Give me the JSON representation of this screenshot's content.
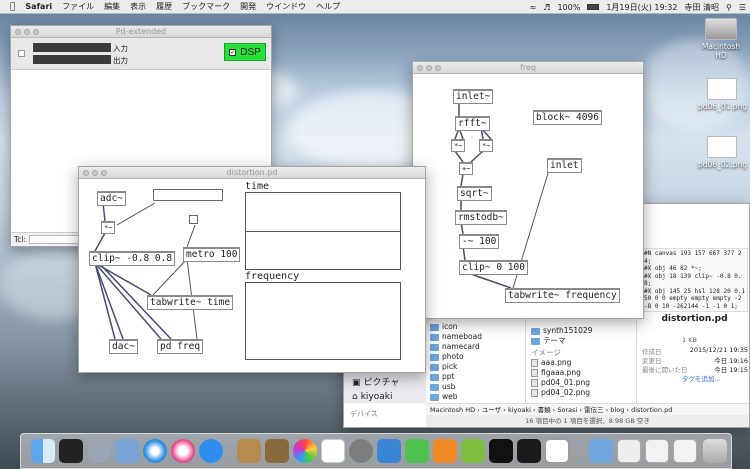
{
  "menubar": {
    "app": "Safari",
    "menus": [
      "ファイル",
      "編集",
      "表示",
      "履歴",
      "ブックマーク",
      "開発",
      "ウインドウ",
      "ヘルプ"
    ],
    "battery": "100%",
    "datetime": "1月19日(火)  19:32",
    "user": "寺田 清昭"
  },
  "pd_main": {
    "title": "Pd-extended",
    "input_label": "入力",
    "output_label": "出力",
    "dsp_label": "DSP",
    "tcl_label": "Tcl:"
  },
  "distortion": {
    "title": "distortion.pd",
    "array_time_label": "time",
    "array_freq_label": "frequency",
    "objects": {
      "adc": "adc~",
      "mult": "*~",
      "clip": "clip~ -0.8 0.8",
      "metro": "metro 100",
      "tabwrite": "tabwrite~ time",
      "dac": "dac~",
      "pd_freq": "pd freq"
    }
  },
  "freq": {
    "title": "freq",
    "objects": {
      "inlet_sig": "inlet~",
      "rfft": "rfft~",
      "mult_a": "*~",
      "mult_b": "*~",
      "plus": "+~",
      "sqrt": "sqrt~",
      "rmstodb": "rmstodb~",
      "minus": "-~ 100",
      "clip": "clip~ 0 100",
      "tabwrite": "tabwrite~ frequency",
      "block": "block~ 4096",
      "inlet": "inlet"
    }
  },
  "finder": {
    "sidebar": [
      "ピクチャ",
      "kiyoaki",
      "デバイス"
    ],
    "col1": [
      "icon",
      "nameboad",
      "namecard",
      "photo",
      "pick",
      "ppt",
      "usb",
      "web"
    ],
    "col2_folders": [
      "synth151029",
      "テーマ"
    ],
    "col2_header": "イメージ",
    "col2_files": [
      "aaa.png",
      "figaaa.png",
      "pd04_01.png",
      "pd04_02.png"
    ],
    "preview_text": "#N canvas 193 157 667 377 24;\n#X obj 46 82 *~;\n#X obj 18 139 clip~ -0.8 0.8;\n#X obj 145 25 hsl 128 20 0.1 50 0 0 empty empty empty -2 -8 0 10 -262144 -1 -1 0 1;",
    "file_name": "distortion.pd",
    "file_size": "1 KB",
    "info": [
      {
        "k": "作成日",
        "v": "2015/12/21 19:35"
      },
      {
        "k": "変更日",
        "v": "今日 19:16"
      },
      {
        "k": "最後に開いた日",
        "v": "今日 19:15"
      }
    ],
    "add_tag": "タグを追加...",
    "path": [
      "Macintosh HD",
      "ユーザ",
      "kiyoaki",
      "書類",
      "Sorasi",
      "雷伝三",
      "blog",
      "distortion.pd"
    ],
    "status": "16 項目中の 1 項目を選択、8.98 GB 空き"
  },
  "desktop": {
    "icons": [
      "Macintosh HD",
      "pd06_01.png",
      "pd06_02.png"
    ]
  },
  "colors": {
    "dsp_on": "#27e03a",
    "wire": "#4a4a7a",
    "signal_wire": "#6a5a9a"
  }
}
